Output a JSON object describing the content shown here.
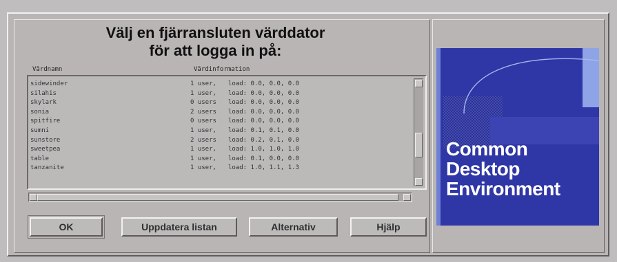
{
  "dialog": {
    "title_line1": "Välj en fjärransluten värddator",
    "title_line2": "för att logga in på:",
    "col_host_name": "Värdnamn",
    "col_host_info": "Värdinformation"
  },
  "hosts": [
    {
      "name": "sidewinder",
      "users": "1 user,",
      "load": "load: 0.0, 0.0, 0.0"
    },
    {
      "name": "silahis",
      "users": "1 user,",
      "load": "load: 0.0, 0.0, 0.0"
    },
    {
      "name": "skylark",
      "users": "0 users",
      "load": "load: 0.0, 0.0, 0.0"
    },
    {
      "name": "sonia",
      "users": "2 users",
      "load": "load: 0.0, 0.0, 0.0"
    },
    {
      "name": "spitfire",
      "users": "0 users",
      "load": "load: 0.0, 0.0, 0.0"
    },
    {
      "name": "sumni",
      "users": "1 user,",
      "load": "load: 0.1, 0.1, 0.0"
    },
    {
      "name": "sunstore",
      "users": "2 users",
      "load": "load: 0.2, 0.1, 0.0"
    },
    {
      "name": "sweetpea",
      "users": "1 user,",
      "load": "load: 1.0, 1.0, 1.0"
    },
    {
      "name": "table",
      "users": "1 user,",
      "load": "load: 0.1, 0.0, 0.0"
    },
    {
      "name": "tanzanite",
      "users": "1 user,",
      "load": "load: 1.0, 1.1, 1.3"
    }
  ],
  "buttons": {
    "ok": "OK",
    "refresh": "Uppdatera listan",
    "options": "Alternativ",
    "help": "Hjälp"
  },
  "logo": {
    "line1": "Common",
    "line2": "Desktop",
    "line3": "Environment"
  },
  "colors": {
    "logo_blue": "#2f36a6",
    "logo_light_blue": "#8ea4e6",
    "panel_gray": "#b9b5b5"
  }
}
